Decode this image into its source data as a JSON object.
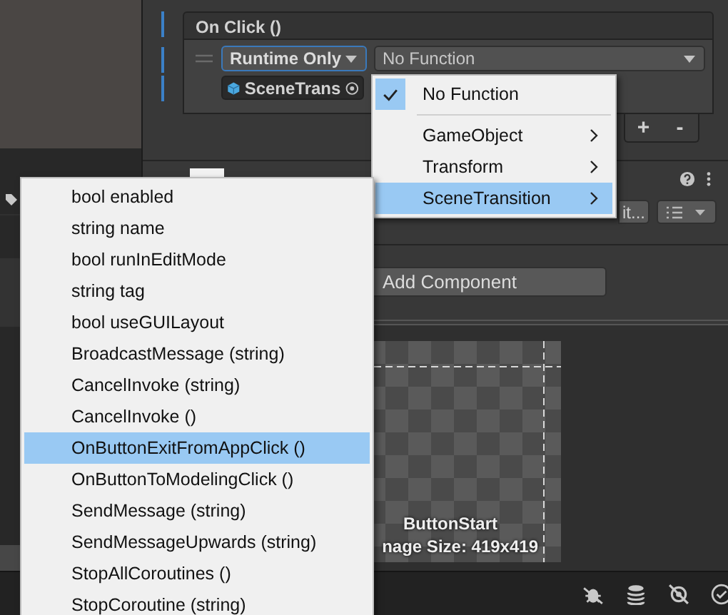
{
  "event": {
    "title": "On Click ()",
    "mode": "Runtime Only",
    "function": "No Function",
    "target": "SceneTrans"
  },
  "list_buttons": [
    "+",
    "-"
  ],
  "component_header": {
    "edit_button": "it..."
  },
  "add_component": "Add Component",
  "preview": {
    "name": "ButtonStart",
    "size": "nage Size: 419x419"
  },
  "function_menu": {
    "items": [
      {
        "kind": "item",
        "label": "No Function",
        "checked": true,
        "highlighted": false,
        "has_submenu": false
      },
      {
        "kind": "separator"
      },
      {
        "kind": "item",
        "label": "GameObject",
        "checked": false,
        "highlighted": false,
        "has_submenu": true
      },
      {
        "kind": "item",
        "label": "Transform",
        "checked": false,
        "highlighted": false,
        "has_submenu": true
      },
      {
        "kind": "item",
        "label": "SceneTransition",
        "checked": false,
        "highlighted": true,
        "has_submenu": true
      }
    ]
  },
  "method_menu": {
    "items": [
      {
        "label": "bool enabled",
        "highlighted": false
      },
      {
        "label": "string name",
        "highlighted": false
      },
      {
        "label": "bool runInEditMode",
        "highlighted": false
      },
      {
        "label": "string tag",
        "highlighted": false
      },
      {
        "label": "bool useGUILayout",
        "highlighted": false
      },
      {
        "label": "BroadcastMessage (string)",
        "highlighted": false
      },
      {
        "label": "CancelInvoke (string)",
        "highlighted": false
      },
      {
        "label": "CancelInvoke ()",
        "highlighted": false
      },
      {
        "label": "OnButtonExitFromAppClick ()",
        "highlighted": true
      },
      {
        "label": "OnButtonToModelingClick ()",
        "highlighted": false
      },
      {
        "label": "SendMessage (string)",
        "highlighted": false
      },
      {
        "label": "SendMessageUpwards (string)",
        "highlighted": false
      },
      {
        "label": "StopAllCoroutines ()",
        "highlighted": false
      },
      {
        "label": "StopCoroutine (string)",
        "highlighted": false
      }
    ]
  }
}
